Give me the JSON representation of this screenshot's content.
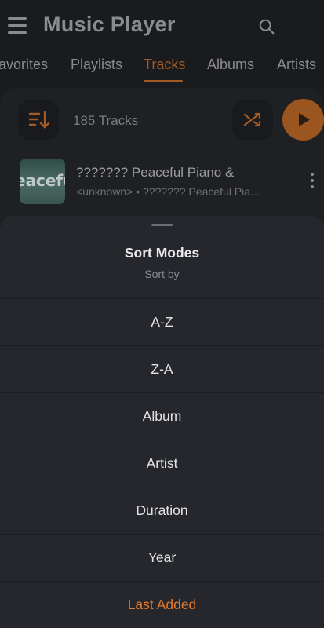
{
  "app": {
    "title": "Music Player"
  },
  "tabs": [
    {
      "label": "avorites"
    },
    {
      "label": "Playlists"
    },
    {
      "label": "Tracks",
      "active": true
    },
    {
      "label": "Albums"
    },
    {
      "label": "Artists"
    }
  ],
  "tracks_header": {
    "count": "185 Tracks"
  },
  "track": {
    "art_text": "eacefu",
    "title": "??????? Peaceful Piano &",
    "subtitle": "<unknown>  •  ??????? Peaceful Pia..."
  },
  "sort_sheet": {
    "title": "Sort Modes",
    "subtitle": "Sort by",
    "options": [
      {
        "label": "A-Z"
      },
      {
        "label": "Z-A"
      },
      {
        "label": "Album"
      },
      {
        "label": "Artist"
      },
      {
        "label": "Duration"
      },
      {
        "label": "Year"
      },
      {
        "label": "Last Added",
        "selected": true
      }
    ]
  },
  "colors": {
    "accent": "#e07a2c",
    "accent_dim": "#a25a24",
    "sheet_bg": "#25272c",
    "screen_bg": "#1a1b1e"
  },
  "icons": {
    "menu": "menu-icon",
    "search": "search-icon",
    "sort": "sort-icon",
    "shuffle": "shuffle-icon",
    "play": "play-icon",
    "more": "more-vert-icon"
  }
}
